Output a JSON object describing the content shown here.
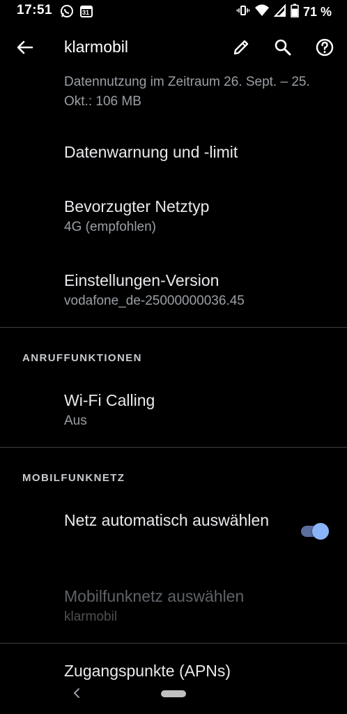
{
  "status_bar": {
    "time": "17:51",
    "left_icons": [
      "whatsapp-icon",
      "calendar-icon"
    ],
    "calendar_day": "31",
    "right_icons": [
      "vibrate-icon",
      "wifi-icon",
      "signal-icon",
      "battery-icon"
    ],
    "battery_percent": "71 %"
  },
  "app_bar": {
    "title": "klarmobil",
    "actions": [
      "edit-icon",
      "search-icon",
      "help-icon"
    ]
  },
  "data_usage": {
    "text": "Datennutzung im Zeitraum 26. Sept. – 25. Okt.: 106 MB"
  },
  "prefs": {
    "data_warning": {
      "title": "Datenwarnung und -limit"
    },
    "network_type": {
      "title": "Bevorzugter Netztyp",
      "summary": "4G (empfohlen)"
    },
    "settings_version": {
      "title": "Einstellungen-Version",
      "summary": "vodafone_de-25000000036.45"
    }
  },
  "call_section": {
    "header": "ANRUFFUNKTIONEN",
    "wifi_calling": {
      "title": "Wi-Fi Calling",
      "summary": "Aus"
    }
  },
  "mobile_section": {
    "header": "MOBILFUNKNETZ",
    "auto_select": {
      "title": "Netz automatisch auswählen",
      "enabled": true
    },
    "choose_network": {
      "title": "Mobilfunknetz auswählen",
      "summary": "klarmobil",
      "disabled": true
    },
    "apn": {
      "title": "Zugangspunkte (APNs)"
    }
  },
  "colors": {
    "background": "#000000",
    "accent": "#8ab4f8",
    "text_primary": "#e8eaed",
    "text_secondary": "#9aa0a6"
  }
}
